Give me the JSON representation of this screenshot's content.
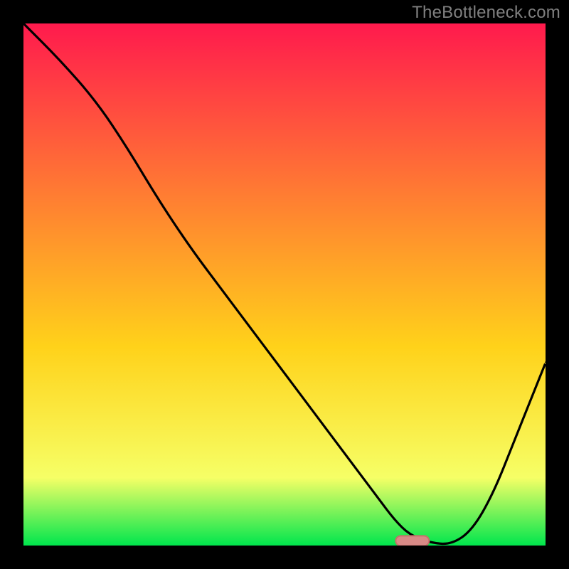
{
  "watermark": "TheBottleneck.com",
  "colors": {
    "gradient_top": "#ff1a4d",
    "gradient_mid1": "#ff7a33",
    "gradient_mid2": "#ffd21a",
    "gradient_mid3": "#f6ff66",
    "gradient_bottom": "#00e64d",
    "line": "#000000",
    "marker_fill": "#d88a86",
    "marker_stroke": "#c76f6b",
    "frame": "#000000"
  },
  "chart_data": {
    "type": "line",
    "title": "",
    "xlabel": "",
    "ylabel": "",
    "x_range": [
      0,
      100
    ],
    "y_range": [
      0,
      100
    ],
    "series": [
      {
        "name": "curve",
        "x": [
          0,
          7,
          14,
          20,
          26,
          32,
          38,
          44,
          50,
          56,
          62,
          68,
          71,
          74,
          78,
          82,
          86,
          90,
          94,
          98,
          100
        ],
        "y": [
          100,
          93,
          85,
          76,
          66,
          57,
          49,
          41,
          33,
          25,
          17,
          9,
          5,
          2,
          0.5,
          0.2,
          3,
          10,
          20,
          30,
          35
        ]
      }
    ],
    "marker": {
      "x_center": 74.5,
      "x_halfwidth": 3.2,
      "y": 0.9
    },
    "annotations": [],
    "legend": null,
    "grid": false
  }
}
